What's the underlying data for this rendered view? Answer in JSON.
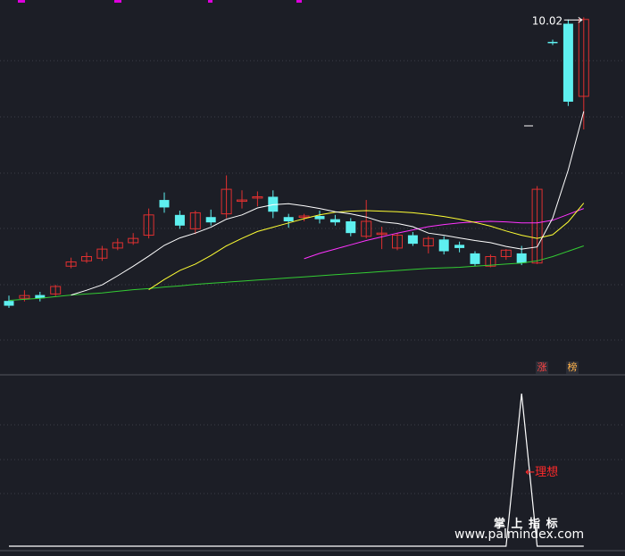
{
  "colors": {
    "background": "#1c1e26",
    "grid": "#3b3d48",
    "up": "#e03030",
    "down": "#5ef0f0",
    "ma5": "#ffffff",
    "ma10": "#ffff33",
    "ma20": "#ff33ff",
    "ma60": "#33cc33",
    "indicator": "#ffffff",
    "annotation": "#ff2a2a",
    "top_ticks": "#dd00dd"
  },
  "chart_data": [
    {
      "type": "candlestick",
      "title": "",
      "max_label": "10.02",
      "ylim": [
        3.6,
        10.25
      ],
      "candles": [
        {
          "o": 4.75,
          "c": 4.66,
          "h": 4.85,
          "l": 4.62
        },
        {
          "o": 4.8,
          "c": 4.85,
          "h": 4.95,
          "l": 4.74
        },
        {
          "o": 4.86,
          "c": 4.8,
          "h": 4.92,
          "l": 4.74
        },
        {
          "o": 4.88,
          "c": 5.02,
          "h": 5.05,
          "l": 4.84
        },
        {
          "o": 5.4,
          "c": 5.48,
          "h": 5.56,
          "l": 5.36
        },
        {
          "o": 5.5,
          "c": 5.58,
          "h": 5.66,
          "l": 5.46
        },
        {
          "o": 5.55,
          "c": 5.72,
          "h": 5.78,
          "l": 5.5
        },
        {
          "o": 5.74,
          "c": 5.84,
          "h": 5.92,
          "l": 5.7
        },
        {
          "o": 5.84,
          "c": 5.92,
          "h": 6.02,
          "l": 5.8
        },
        {
          "o": 5.98,
          "c": 6.36,
          "h": 6.48,
          "l": 5.92
        },
        {
          "o": 6.64,
          "c": 6.5,
          "h": 6.78,
          "l": 6.4
        },
        {
          "o": 6.36,
          "c": 6.16,
          "h": 6.44,
          "l": 6.1
        },
        {
          "o": 6.1,
          "c": 6.4,
          "h": 6.44,
          "l": 6.0
        },
        {
          "o": 6.32,
          "c": 6.22,
          "h": 6.46,
          "l": 6.16
        },
        {
          "o": 6.38,
          "c": 6.84,
          "h": 7.1,
          "l": 6.3
        },
        {
          "o": 6.64,
          "c": 6.64,
          "h": 6.82,
          "l": 6.48
        },
        {
          "o": 6.7,
          "c": 6.7,
          "h": 6.8,
          "l": 6.52
        },
        {
          "o": 6.7,
          "c": 6.42,
          "h": 6.82,
          "l": 6.3
        },
        {
          "o": 6.32,
          "c": 6.24,
          "h": 6.38,
          "l": 6.12
        },
        {
          "o": 6.34,
          "c": 6.34,
          "h": 6.38,
          "l": 6.24
        },
        {
          "o": 6.34,
          "c": 6.28,
          "h": 6.44,
          "l": 6.2
        },
        {
          "o": 6.28,
          "c": 6.22,
          "h": 6.36,
          "l": 6.16
        },
        {
          "o": 6.24,
          "c": 6.02,
          "h": 6.3,
          "l": 5.96
        },
        {
          "o": 5.96,
          "c": 6.24,
          "h": 6.64,
          "l": 5.92
        },
        {
          "o": 6.02,
          "c": 6.02,
          "h": 6.14,
          "l": 5.72
        },
        {
          "o": 5.74,
          "c": 5.98,
          "h": 6.02,
          "l": 5.7
        },
        {
          "o": 5.98,
          "c": 5.82,
          "h": 6.04,
          "l": 5.78
        },
        {
          "o": 5.78,
          "c": 5.92,
          "h": 5.96,
          "l": 5.64
        },
        {
          "o": 5.9,
          "c": 5.68,
          "h": 5.96,
          "l": 5.62
        },
        {
          "o": 5.8,
          "c": 5.74,
          "h": 5.86,
          "l": 5.66
        },
        {
          "o": 5.64,
          "c": 5.44,
          "h": 5.68,
          "l": 5.4
        },
        {
          "o": 5.4,
          "c": 5.58,
          "h": 5.62,
          "l": 5.38
        },
        {
          "o": 5.58,
          "c": 5.7,
          "h": 5.72,
          "l": 5.52
        },
        {
          "o": 5.64,
          "c": 5.46,
          "h": 5.78,
          "l": 5.42
        },
        {
          "o": 5.46,
          "c": 6.84,
          "h": 6.9,
          "l": 5.44
        },
        {
          "o": 9.6,
          "c": 9.58,
          "h": 9.64,
          "l": 9.54
        },
        {
          "o": 9.94,
          "c": 8.48,
          "h": 10.02,
          "l": 8.4
        },
        {
          "o": 8.58,
          "c": 10.02,
          "h": 10.06,
          "l": 7.96
        }
      ],
      "ma5": [
        null,
        null,
        null,
        null,
        4.86,
        4.95,
        5.05,
        5.22,
        5.4,
        5.59,
        5.79,
        5.93,
        6.02,
        6.13,
        6.28,
        6.36,
        6.49,
        6.55,
        6.57,
        6.53,
        6.48,
        6.42,
        6.38,
        6.32,
        6.23,
        6.2,
        6.14,
        6.02,
        5.98,
        5.93,
        5.88,
        5.84,
        5.77,
        5.72,
        5.76,
        6.3,
        7.2,
        8.3
      ],
      "ma10": [
        null,
        null,
        null,
        null,
        null,
        null,
        null,
        null,
        null,
        4.96,
        5.15,
        5.32,
        5.44,
        5.6,
        5.78,
        5.92,
        6.05,
        6.13,
        6.21,
        6.29,
        6.36,
        6.41,
        6.43,
        6.44,
        6.43,
        6.42,
        6.4,
        6.37,
        6.33,
        6.28,
        6.22,
        6.15,
        6.06,
        5.98,
        5.92,
        5.99,
        6.23,
        6.58
      ],
      "ma20": [
        null,
        null,
        null,
        null,
        null,
        null,
        null,
        null,
        null,
        null,
        null,
        null,
        null,
        null,
        null,
        null,
        null,
        null,
        null,
        5.54,
        5.64,
        5.72,
        5.8,
        5.88,
        5.95,
        6.02,
        6.08,
        6.14,
        6.18,
        6.21,
        6.23,
        6.24,
        6.23,
        6.21,
        6.21,
        6.26,
        6.37,
        6.48
      ],
      "ma60": [
        4.76,
        4.78,
        4.8,
        4.83,
        4.86,
        4.88,
        4.9,
        4.93,
        4.96,
        4.98,
        5.01,
        5.03,
        5.06,
        5.08,
        5.1,
        5.12,
        5.14,
        5.16,
        5.18,
        5.2,
        5.22,
        5.24,
        5.26,
        5.28,
        5.3,
        5.32,
        5.34,
        5.36,
        5.37,
        5.38,
        5.4,
        5.42,
        5.44,
        5.46,
        5.5,
        5.58,
        5.68,
        5.78
      ]
    },
    {
      "type": "line",
      "title": "",
      "annotation": "←理想",
      "ylim": [
        0,
        1
      ],
      "values": [
        0,
        0,
        0,
        0,
        0,
        0,
        0,
        0,
        0,
        0,
        0,
        0,
        0,
        0,
        0,
        0,
        0,
        0,
        0,
        0,
        0,
        0,
        0,
        0,
        0,
        0,
        0,
        0,
        0,
        0,
        0,
        0,
        0,
        1,
        0,
        0,
        0,
        0
      ]
    }
  ],
  "badges": [
    {
      "label": "涨",
      "color": "#ff4444"
    },
    {
      "label": "榜",
      "color": "#ffb24a"
    }
  ],
  "watermark": {
    "line1": "掌 上 指 标",
    "line2": "www.palmindex.com"
  }
}
